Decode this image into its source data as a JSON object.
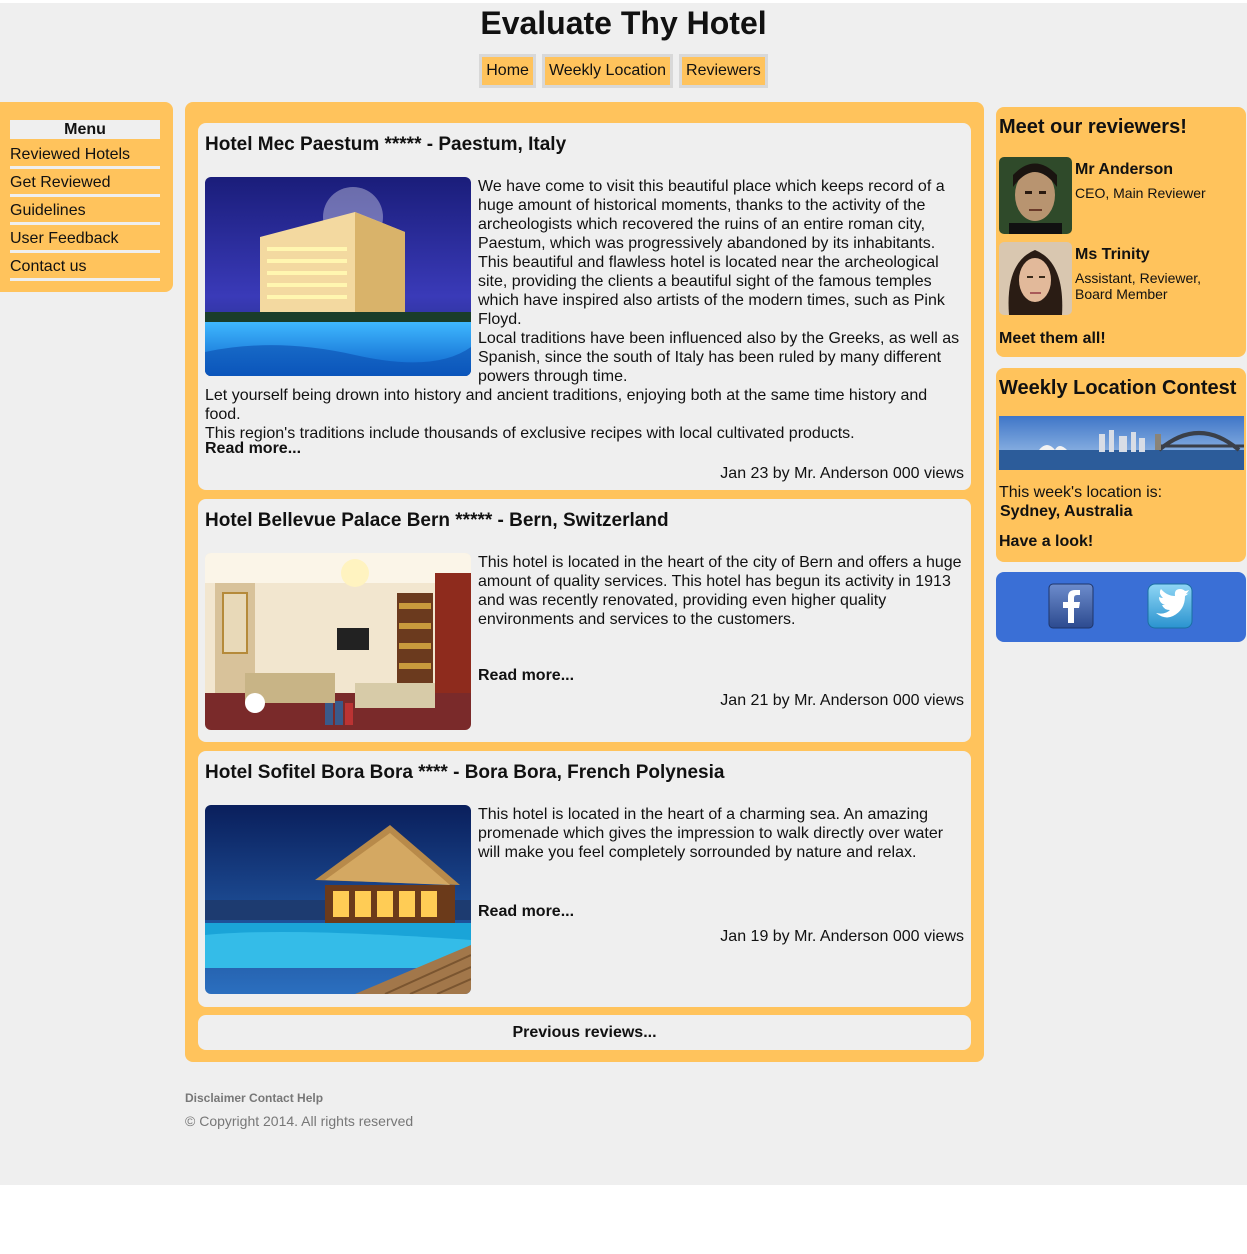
{
  "site": {
    "title": "Evaluate Thy Hotel"
  },
  "nav": {
    "items": [
      {
        "label": "Home"
      },
      {
        "label": "Weekly Location"
      },
      {
        "label": "Reviewers"
      }
    ]
  },
  "menu": {
    "title": "Menu",
    "items": [
      {
        "label": "Reviewed Hotels"
      },
      {
        "label": "Get Reviewed"
      },
      {
        "label": "Guidelines"
      },
      {
        "label": "User Feedback"
      },
      {
        "label": "Contact us"
      }
    ]
  },
  "articles": [
    {
      "title": "Hotel Mec Paestum ***** - Paestum, Italy",
      "paragraphs": [
        "We have come to visit this beautiful place which keeps record of a huge amount of historical moments, thanks to the activity of the archeologists which recovered the ruins of an entire roman city, Paestum, which was progressively abandoned by its inhabitants.",
        "This beautiful and flawless hotel is located near the archeological site, providing the clients a beautiful sight of the famous temples which have inspired also artists of the modern times, such as Pink Floyd.",
        "Local traditions have been influenced also by the Greeks, as well as Spanish, since the south of Italy has been ruled by many different powers through time.",
        "Let yourself being drown into history and ancient traditions, enjoying both at the same time history and food.",
        "This region's traditions include thousands of exclusive recipes with local cultivated products."
      ],
      "read_more": "Read more...",
      "meta": "Jan 23 by Mr. Anderson 000 views"
    },
    {
      "title": "Hotel Bellevue Palace Bern ***** - Bern, Switzerland",
      "paragraphs": [
        "This hotel is located in the heart of the city of Bern and offers a huge amount of quality services. This hotel has begun its activity in 1913 and was recently renovated, providing even higher quality environments and services to the customers."
      ],
      "read_more": "Read more...",
      "meta": "Jan 21 by Mr. Anderson 000 views"
    },
    {
      "title": "Hotel Sofitel Bora Bora **** - Bora Bora, French Polynesia",
      "paragraphs": [
        "This hotel is located in the heart of a charming sea. An amazing promenade which gives the impression to walk directly over water will make you feel completely sorrounded by nature and relax."
      ],
      "read_more": "Read more...",
      "meta": "Jan 19 by Mr. Anderson 000 views"
    }
  ],
  "pagination": {
    "previous": "Previous reviews..."
  },
  "footer": {
    "links": "Disclaimer Contact Help",
    "copyright": "© Copyright 2014. All rights reserved"
  },
  "reviewers_box": {
    "title": "Meet our reviewers!",
    "reviewers": [
      {
        "name": "Mr Anderson",
        "role": "CEO, Main Reviewer"
      },
      {
        "name": "Ms Trinity",
        "role": "Assistant, Reviewer, Board Member"
      }
    ],
    "link": "Meet them all!"
  },
  "contest_box": {
    "title": "Weekly Location Contest",
    "caption": "This week's location is:",
    "location": "Sydney, Australia",
    "link": "Have a look!"
  },
  "social": {
    "icons": [
      "facebook-icon",
      "twitter-icon"
    ]
  },
  "colors": {
    "accent": "#ffc35c",
    "background": "#efefef",
    "social": "#3a6fd6"
  }
}
